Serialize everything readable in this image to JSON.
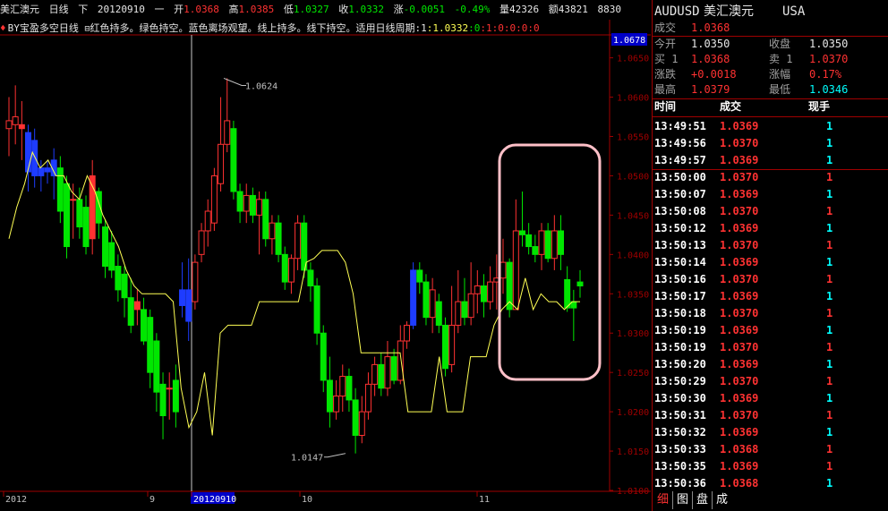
{
  "header": {
    "symbol_name": "美汇澳元",
    "period": "日线",
    "direction": "下",
    "date": "20120910",
    "dash": "一",
    "open_label": "开",
    "open_value": "1.0368",
    "high_label": "高",
    "high_value": "1.0385",
    "low_label": "低",
    "low_value": "1.0327",
    "close_label": "收",
    "close_value": "1.0332",
    "change_label": "涨",
    "change_value": "-0.0051",
    "change_pct": "-0.49%",
    "volume_label": "量",
    "volume_value": "42326",
    "amount_label": "额",
    "amount_value": "43821",
    "extra_value": "8830"
  },
  "indicator": {
    "name": "BY宝盈多空日线",
    "description": "红色持多。绿色持空。蓝色离场观望。线上持多。线下持空。适用日线周期:1",
    "values": [
      ":1.0332",
      ":0",
      ":1",
      ":0",
      ":0",
      ":0",
      ":0"
    ]
  },
  "price_axis": {
    "labels": [
      "1.0650",
      "1.0600",
      "1.0550",
      "1.0500",
      "1.0450",
      "1.0400",
      "1.0350",
      "1.0300",
      "1.0250",
      "1.0200",
      "1.0150",
      "1.0100"
    ],
    "current_price": "1.0678"
  },
  "time_axis": {
    "labels": [
      "2012",
      "9",
      "20120910",
      "10",
      "11"
    ]
  },
  "annotations": {
    "high_mark": "1.0624",
    "low_mark": "1.0147"
  },
  "chart_data": {
    "type": "candlestick",
    "ylim": [
      1.01,
      1.068
    ],
    "candles": [
      [
        1.056,
        1.057,
        1.0525,
        1.06
      ],
      [
        1.0565,
        1.0575,
        1.054,
        1.0615
      ],
      [
        1.0565,
        1.056,
        1.052,
        1.0595
      ],
      [
        1.0555,
        1.0505,
        1.048,
        1.0565
      ],
      [
        1.0545,
        1.05,
        1.0485,
        1.056
      ],
      [
        1.051,
        1.05,
        1.048,
        1.052
      ],
      [
        1.051,
        1.0505,
        1.049,
        1.052
      ],
      [
        1.052,
        1.05,
        1.047,
        1.0535
      ],
      [
        1.051,
        1.0455,
        1.044,
        1.0525
      ],
      [
        1.049,
        1.041,
        1.0395,
        1.05
      ],
      [
        1.047,
        1.047,
        1.042,
        1.049
      ],
      [
        1.047,
        1.0435,
        1.042,
        1.0485
      ],
      [
        1.046,
        1.041,
        1.04,
        1.0475
      ],
      [
        1.05,
        1.042,
        1.04,
        1.052
      ],
      [
        1.048,
        1.044,
        1.042,
        1.0485
      ],
      [
        1.0435,
        1.0385,
        1.037,
        1.0445
      ],
      [
        1.0415,
        1.038,
        1.037,
        1.043
      ],
      [
        1.0385,
        1.0355,
        1.034,
        1.04
      ],
      [
        1.0375,
        1.0345,
        1.032,
        1.0385
      ],
      [
        1.0345,
        1.031,
        1.03,
        1.037
      ],
      [
        1.034,
        1.033,
        1.031,
        1.0355
      ],
      [
        1.033,
        1.029,
        1.0285,
        1.0345
      ],
      [
        1.032,
        1.025,
        1.023,
        1.033
      ],
      [
        1.029,
        1.0225,
        1.02,
        1.03
      ],
      [
        1.0235,
        1.0195,
        1.0165,
        1.025
      ],
      [
        1.023,
        1.023,
        1.019,
        1.025
      ],
      [
        1.024,
        1.02,
        1.018,
        1.026
      ],
      [
        1.0335,
        1.0355,
        1.032,
        1.039
      ],
      [
        1.0355,
        1.0315,
        1.029,
        1.0395
      ],
      [
        1.034,
        1.039,
        1.033,
        1.04
      ],
      [
        1.04,
        1.043,
        1.039,
        1.044
      ],
      [
        1.043,
        1.0455,
        1.041,
        1.047
      ],
      [
        1.044,
        1.05,
        1.043,
        1.051
      ],
      [
        1.049,
        1.054,
        1.048,
        1.06
      ],
      [
        1.054,
        1.057,
        1.053,
        1.0624
      ],
      [
        1.056,
        1.048,
        1.047,
        1.057
      ],
      [
        1.048,
        1.0455,
        1.044,
        1.049
      ],
      [
        1.0455,
        1.0475,
        1.044,
        1.049
      ],
      [
        1.0475,
        1.045,
        1.044,
        1.0485
      ],
      [
        1.045,
        1.047,
        1.04,
        1.048
      ],
      [
        1.047,
        1.042,
        1.041,
        1.048
      ],
      [
        1.042,
        1.044,
        1.04,
        1.045
      ],
      [
        1.044,
        1.04,
        1.039,
        1.045
      ],
      [
        1.04,
        1.0365,
        1.0355,
        1.041
      ],
      [
        1.0365,
        1.0395,
        1.035,
        1.04
      ],
      [
        1.0395,
        1.044,
        1.038,
        1.045
      ],
      [
        1.044,
        1.038,
        1.037,
        1.045
      ],
      [
        1.038,
        1.036,
        1.034,
        1.039
      ],
      [
        1.036,
        1.03,
        1.0285,
        1.037
      ],
      [
        1.03,
        1.024,
        1.0225,
        1.031
      ],
      [
        1.024,
        1.02,
        1.018,
        1.027
      ],
      [
        1.02,
        1.022,
        1.019,
        1.024
      ],
      [
        1.022,
        1.0245,
        1.02,
        1.026
      ],
      [
        1.0245,
        1.0215,
        1.02,
        1.0255
      ],
      [
        1.0215,
        1.017,
        1.0147,
        1.023
      ],
      [
        1.017,
        1.02,
        1.016,
        1.022
      ],
      [
        1.02,
        1.0235,
        1.019,
        1.025
      ],
      [
        1.0235,
        1.026,
        1.022,
        1.027
      ],
      [
        1.026,
        1.023,
        1.022,
        1.0275
      ],
      [
        1.023,
        1.027,
        1.022,
        1.029
      ],
      [
        1.027,
        1.024,
        1.0235,
        1.028
      ],
      [
        1.024,
        1.029,
        1.0235,
        1.031
      ],
      [
        1.029,
        1.031,
        1.028,
        1.0315
      ],
      [
        1.031,
        1.038,
        1.0305,
        1.039
      ],
      [
        1.038,
        1.0365,
        1.035,
        1.039
      ],
      [
        1.0365,
        1.032,
        1.031,
        1.0375
      ],
      [
        1.032,
        1.0355,
        1.03,
        1.037
      ],
      [
        1.034,
        1.031,
        1.03,
        1.035
      ],
      [
        1.031,
        1.0255,
        1.0245,
        1.032
      ],
      [
        1.026,
        1.031,
        1.025,
        1.036
      ],
      [
        1.031,
        1.034,
        1.03,
        1.038
      ],
      [
        1.034,
        1.032,
        1.031,
        1.037
      ],
      [
        1.032,
        1.035,
        1.031,
        1.039
      ],
      [
        1.035,
        1.036,
        1.0325,
        1.038
      ],
      [
        1.036,
        1.034,
        1.032,
        1.0375
      ],
      [
        1.034,
        1.0365,
        1.033,
        1.0385
      ],
      [
        1.0365,
        1.037,
        1.033,
        1.04
      ],
      [
        1.037,
        1.039,
        1.035,
        1.042
      ],
      [
        1.039,
        1.033,
        1.032,
        1.0395
      ],
      [
        1.033,
        1.043,
        1.033,
        1.047
      ],
      [
        1.043,
        1.0425,
        1.041,
        1.048
      ],
      [
        1.0425,
        1.041,
        1.04,
        1.044
      ],
      [
        1.041,
        1.04,
        1.039,
        1.0425
      ],
      [
        1.04,
        1.043,
        1.038,
        1.044
      ],
      [
        1.043,
        1.0395,
        1.039,
        1.044
      ],
      [
        1.0395,
        1.043,
        1.038,
        1.045
      ],
      [
        1.043,
        1.04,
        1.038,
        1.045
      ],
      [
        1.0368,
        1.0332,
        1.0327,
        1.0385
      ],
      [
        1.0332,
        1.034,
        1.029,
        1.0355
      ],
      [
        1.036,
        1.0365,
        1.0345,
        1.038
      ]
    ],
    "candle_colors_note": "red = up, green = down, blue = neutral; colors per candle in colors[]",
    "colors": [
      "r",
      "r",
      "r",
      "b",
      "b",
      "b",
      "b",
      "b",
      "g",
      "g",
      "r",
      "g",
      "g",
      "r",
      "g",
      "g",
      "g",
      "g",
      "g",
      "g",
      "r",
      "g",
      "g",
      "g",
      "g",
      "r",
      "g",
      "b",
      "b",
      "r",
      "r",
      "r",
      "r",
      "r",
      "r",
      "g",
      "g",
      "r",
      "g",
      "r",
      "g",
      "r",
      "g",
      "g",
      "r",
      "r",
      "g",
      "g",
      "g",
      "g",
      "g",
      "r",
      "r",
      "g",
      "g",
      "r",
      "r",
      "r",
      "g",
      "r",
      "g",
      "r",
      "r",
      "b",
      "g",
      "g",
      "r",
      "g",
      "g",
      "r",
      "r",
      "g",
      "r",
      "r",
      "g",
      "r",
      "r",
      "r",
      "g",
      "r",
      "g",
      "g",
      "g",
      "r",
      "g",
      "r",
      "g",
      "g",
      "g",
      "g"
    ],
    "signal_line": [
      1.042,
      1.046,
      1.049,
      1.053,
      1.051,
      1.052,
      1.05,
      1.05,
      1.048,
      1.047,
      1.05,
      1.048,
      1.045,
      1.043,
      1.041,
      1.038,
      1.036,
      1.035,
      1.035,
      1.035,
      1.035,
      1.034,
      1.023,
      1.018,
      1.02,
      1.025,
      1.017,
      1.03,
      1.031,
      1.031,
      1.031,
      1.031,
      1.034,
      1.034,
      1.034,
      1.034,
      1.034,
      1.034,
      1.039,
      1.0395,
      1.0405,
      1.0405,
      1.0405,
      1.039,
      1.035,
      1.0275,
      1.0275,
      1.0275,
      1.0275,
      1.0275,
      1.0275,
      1.02,
      1.02,
      1.02,
      1.02,
      1.027,
      1.02,
      1.02,
      1.02,
      1.027,
      1.027,
      1.027,
      1.031,
      1.033,
      1.034,
      1.033,
      1.037,
      1.033,
      1.035,
      1.034,
      1.034,
      1.033,
      1.034,
      1.034
    ],
    "highlight_box": "rounded rectangle around last candles"
  },
  "quote": {
    "symbol": "AUDUSD",
    "name": "美汇澳元",
    "market": "USA",
    "last_label": "成交",
    "last_value": "1.0368",
    "rows": [
      {
        "l1": "今开",
        "v1": "1.0350",
        "l2": "收盘",
        "v2": "1.0350"
      },
      {
        "l1": "买 1",
        "v1": "1.0368",
        "l2": "卖 1",
        "v2": "1.0370"
      },
      {
        "l1": "涨跌",
        "v1": "+0.0018",
        "l2": "涨幅",
        "v2": "0.17%"
      },
      {
        "l1": "最高",
        "v1": "1.0379",
        "l2": "最低",
        "v2": "1.0346"
      }
    ],
    "tick_header": {
      "time": "时间",
      "price": "成交",
      "vol": "现手"
    },
    "ticks": [
      {
        "time": "13:49:51",
        "price": "1.0369",
        "vol": "1",
        "pc": "red",
        "vc": "cyan"
      },
      {
        "time": "13:49:56",
        "price": "1.0370",
        "vol": "1",
        "pc": "red",
        "vc": "cyan"
      },
      {
        "time": "13:49:57",
        "price": "1.0369",
        "vol": "1",
        "pc": "red",
        "vc": "cyan"
      },
      {
        "time": "13:50:00",
        "price": "1.0370",
        "vol": "1",
        "pc": "red",
        "vc": "red"
      },
      {
        "time": "13:50:07",
        "price": "1.0369",
        "vol": "1",
        "pc": "red",
        "vc": "cyan"
      },
      {
        "time": "13:50:08",
        "price": "1.0370",
        "vol": "1",
        "pc": "red",
        "vc": "red"
      },
      {
        "time": "13:50:12",
        "price": "1.0369",
        "vol": "1",
        "pc": "red",
        "vc": "cyan"
      },
      {
        "time": "13:50:13",
        "price": "1.0370",
        "vol": "1",
        "pc": "red",
        "vc": "red"
      },
      {
        "time": "13:50:14",
        "price": "1.0369",
        "vol": "1",
        "pc": "red",
        "vc": "cyan"
      },
      {
        "time": "13:50:16",
        "price": "1.0370",
        "vol": "1",
        "pc": "red",
        "vc": "red"
      },
      {
        "time": "13:50:17",
        "price": "1.0369",
        "vol": "1",
        "pc": "red",
        "vc": "cyan"
      },
      {
        "time": "13:50:18",
        "price": "1.0370",
        "vol": "1",
        "pc": "red",
        "vc": "red"
      },
      {
        "time": "13:50:19",
        "price": "1.0369",
        "vol": "1",
        "pc": "red",
        "vc": "cyan"
      },
      {
        "time": "13:50:19",
        "price": "1.0370",
        "vol": "1",
        "pc": "red",
        "vc": "red"
      },
      {
        "time": "13:50:20",
        "price": "1.0369",
        "vol": "1",
        "pc": "red",
        "vc": "cyan"
      },
      {
        "time": "13:50:29",
        "price": "1.0370",
        "vol": "1",
        "pc": "red",
        "vc": "red"
      },
      {
        "time": "13:50:30",
        "price": "1.0369",
        "vol": "1",
        "pc": "red",
        "vc": "cyan"
      },
      {
        "time": "13:50:31",
        "price": "1.0370",
        "vol": "1",
        "pc": "red",
        "vc": "red"
      },
      {
        "time": "13:50:32",
        "price": "1.0369",
        "vol": "1",
        "pc": "red",
        "vc": "cyan"
      },
      {
        "time": "13:50:33",
        "price": "1.0368",
        "vol": "1",
        "pc": "red",
        "vc": "red"
      },
      {
        "time": "13:50:35",
        "price": "1.0369",
        "vol": "1",
        "pc": "red",
        "vc": "red"
      },
      {
        "time": "13:50:36",
        "price": "1.0368",
        "vol": "1",
        "pc": "red",
        "vc": "cyan"
      }
    ],
    "tabs": [
      "细",
      "图",
      "盘",
      "成"
    ]
  }
}
